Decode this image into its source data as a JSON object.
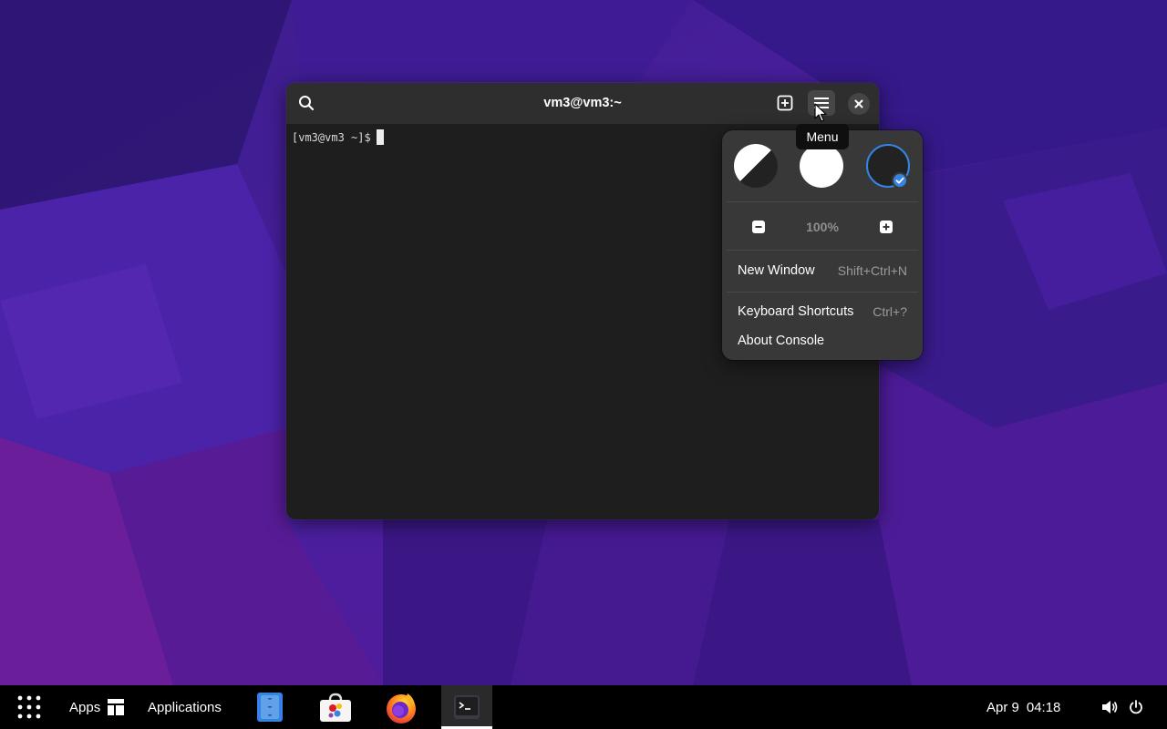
{
  "window": {
    "title": "vm3@vm3:~",
    "prompt": "[vm3@vm3 ~]$"
  },
  "tooltip": {
    "text": "Menu"
  },
  "menu": {
    "styles": [
      {
        "name": "follow-system-style",
        "selected": false
      },
      {
        "name": "light-style",
        "selected": false
      },
      {
        "name": "dark-style",
        "selected": true
      }
    ],
    "zoom_level": "100%",
    "items": [
      {
        "label": "New Window",
        "accel": "Shift+Ctrl+N"
      },
      {
        "label": "Keyboard Shortcuts",
        "accel": "Ctrl+?"
      },
      {
        "label": "About Console",
        "accel": ""
      }
    ]
  },
  "taskbar": {
    "apps_label": "Apps",
    "applications_label": "Applications",
    "dock": [
      "file-manager-icon",
      "software-store-icon",
      "firefox-icon",
      "terminal-icon"
    ],
    "date": "Apr 9",
    "time": "04:18"
  },
  "colors": {
    "accent": "#3584e4",
    "window_bg": "#1e1e1e",
    "headerbar_bg": "#2e2e2e",
    "popover_bg": "#383838"
  }
}
